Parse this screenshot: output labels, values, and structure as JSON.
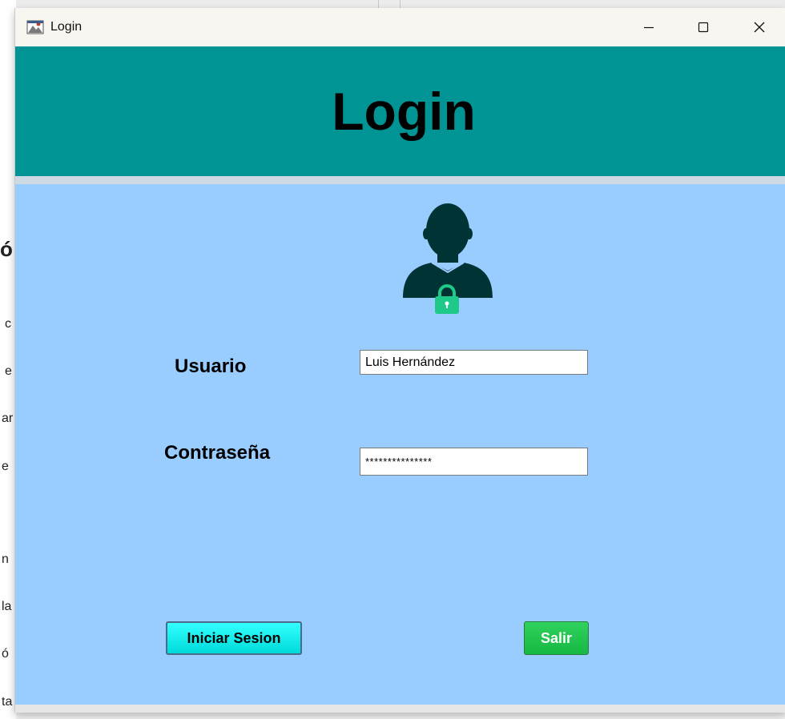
{
  "window": {
    "title": "Login",
    "controls": {
      "minimize_icon": "minimize-icon",
      "maximize_icon": "maximize-icon",
      "close_icon": "close-icon"
    }
  },
  "header": {
    "heading": "Login",
    "background_color": "#009494"
  },
  "form": {
    "user_icon": "user-lock-icon",
    "username_label": "Usuario",
    "username_value": "Luis Hernández",
    "password_label": "Contraseña",
    "password_value": "***************",
    "background_color": "#99ccff"
  },
  "buttons": {
    "login_label": "Iniciar Sesion",
    "exit_label": "Salir",
    "login_color": "#00e5e5",
    "exit_color": "#1fc24c"
  },
  "background_fragments": [
    "ó",
    "c",
    "e",
    "ar",
    "e",
    "n",
    "la",
    "ó",
    "ta"
  ]
}
